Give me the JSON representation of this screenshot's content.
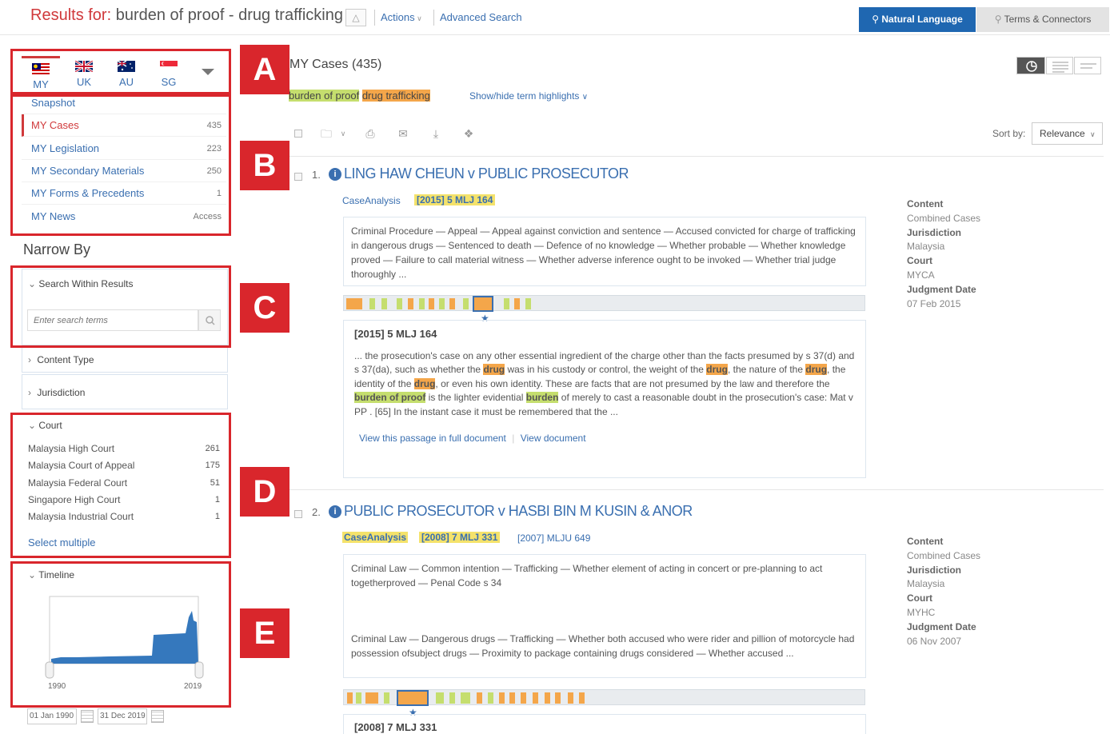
{
  "header": {
    "results_for_label": "Results for:",
    "query": "burden of proof - drug trafficking",
    "actions_label": "Actions",
    "advanced_search_label": "Advanced Search",
    "natural_language_label": "Natural Language",
    "terms_connectors_label": "Terms & Connectors"
  },
  "jurisdiction_tabs": [
    {
      "code": "MY"
    },
    {
      "code": "UK"
    },
    {
      "code": "AU"
    },
    {
      "code": "SG"
    }
  ],
  "sidebar": {
    "items": [
      {
        "label": "Snapshot",
        "count": ""
      },
      {
        "label": "MY Cases",
        "count": "435"
      },
      {
        "label": "MY Legislation",
        "count": "223"
      },
      {
        "label": "MY Secondary Materials",
        "count": "250"
      },
      {
        "label": "MY Forms & Precedents",
        "count": "1"
      },
      {
        "label": "MY News",
        "count": "Access"
      }
    ]
  },
  "narrow_by": {
    "title": "Narrow By",
    "search_within_label": "Search Within Results",
    "search_placeholder": "Enter search terms",
    "content_type_label": "Content Type",
    "jurisdiction_label": "Jurisdiction",
    "court_label": "Court",
    "courts": [
      {
        "name": "Malaysia High Court",
        "count": "261"
      },
      {
        "name": "Malaysia Court of Appeal",
        "count": "175"
      },
      {
        "name": "Malaysia Federal Court",
        "count": "51"
      },
      {
        "name": "Singapore High Court",
        "count": "1"
      },
      {
        "name": "Malaysia Industrial Court",
        "count": "1"
      }
    ],
    "select_multiple_label": "Select multiple",
    "timeline_label": "Timeline",
    "timeline_start_year": "1990",
    "timeline_end_year": "2019",
    "date_from": "01 Jan 1990",
    "date_to": "31 Dec 2019"
  },
  "annotations": [
    "A",
    "B",
    "C",
    "D",
    "E"
  ],
  "main": {
    "cases_title": "MY Cases (435)",
    "term_burden": "burden of proof",
    "term_drug": "drug trafficking",
    "show_hide_label": "Show/hide term highlights",
    "sort_label": "Sort by:",
    "sort_value": "Relevance",
    "results": [
      {
        "number": "1.",
        "title": "LING HAW CHEUN v PUBLIC PROSECUTOR",
        "tag1": "CaseAnalysis",
        "tag2": "[2015] 5 MLJ 164",
        "tag3": "",
        "summary": "Criminal Procedure — Appeal — Appeal against conviction and sentence — Accused convicted for charge of trafficking in dangerous drugs — Sentenced to death — Defence of no knowledge — Whether probable — Whether knowledge proved — Failure to call material witness — Whether adverse inference ought to be invoked — Whether trial judge thoroughly ...",
        "summary2": "",
        "passage_citation": "[2015] 5 MLJ 164",
        "passage_p1": "... the prosecution's case on any other essential ingredient of the charge other than the facts presumed by s 37(d) and s 37(da), such as whether the",
        "passage_h1": "drug",
        "passage_p2": "was in his custody or control, the weight of the",
        "passage_h2": "drug",
        "passage_p3": ", the nature of the",
        "passage_h3": "drug",
        "passage_p4": ", the identity of the",
        "passage_h4": "drug",
        "passage_p5": ", or even his own identity. These are facts that are not presumed by the law and therefore the",
        "passage_h5": "burden of proof",
        "passage_p6": "is the lighter evidential",
        "passage_h6": "burden",
        "passage_p7": "of merely to cast a reasonable doubt in the prosecution's case: Mat v PP . [65] In the instant case it must be remembered that the ...",
        "view_passage_label": "View this passage in full document",
        "view_document_label": "View document",
        "meta": {
          "content_label": "Content",
          "content": "Combined Cases",
          "jurisdiction_label": "Jurisdiction",
          "jurisdiction": "Malaysia",
          "court_label": "Court",
          "court": "MYCA",
          "date_label": "Judgment Date",
          "date": "07 Feb 2015"
        }
      },
      {
        "number": "2.",
        "title": "PUBLIC PROSECUTOR v HASBI BIN M KUSIN & ANOR",
        "tag1": "CaseAnalysis",
        "tag2": "[2008] 7 MLJ 331",
        "tag3": "[2007] MLJU 649",
        "summary": "Criminal Law — Common intention — Trafficking — Whether element of acting in concert or pre-planning to act togetherproved — Penal Code s 34",
        "summary2": "Criminal Law — Dangerous drugs — Trafficking — Whether both accused who were rider and pillion of motorcycle had possession ofsubject drugs — Proximity to package containing drugs considered — Whether accused ...",
        "passage_citation": "[2008] 7 MLJ 331",
        "meta": {
          "content_label": "Content",
          "content": "Combined Cases",
          "jurisdiction_label": "Jurisdiction",
          "jurisdiction": "Malaysia",
          "court_label": "Court",
          "court": "MYHC",
          "date_label": "Judgment Date",
          "date": "06 Nov 2007"
        }
      }
    ]
  },
  "colors": {
    "brand_red": "#d0393b",
    "link_blue": "#3a6fb0",
    "annotation_red": "#d9262c",
    "timeline_fill": "#3578bd",
    "highlight_green": "#c5de6e",
    "highlight_orange": "#f4a64a",
    "highlight_yellow": "#f4e26b"
  }
}
